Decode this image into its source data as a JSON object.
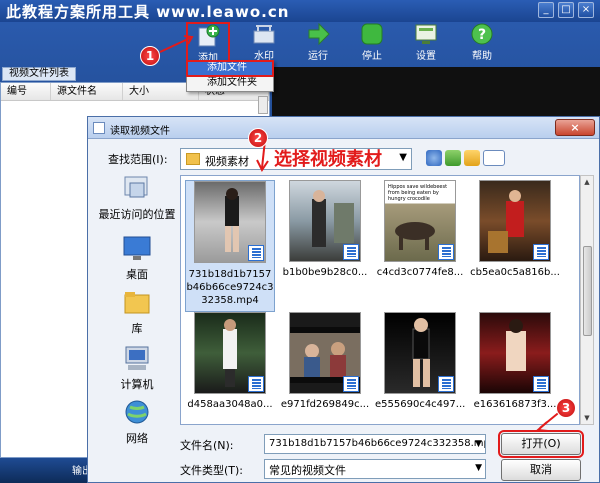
{
  "app": {
    "title": "此教程方案所用工具 www.leawo.cn",
    "window_buttons": [
      "_",
      "□",
      "×"
    ],
    "toolbar": [
      {
        "label": "添加",
        "icon": "add-file-icon"
      },
      {
        "label": "水印",
        "icon": "watermark-icon"
      },
      {
        "label": "运行",
        "icon": "run-icon"
      },
      {
        "label": "停止",
        "icon": "stop-icon"
      },
      {
        "label": "设置",
        "icon": "settings-icon"
      },
      {
        "label": "帮助",
        "icon": "help-icon"
      }
    ],
    "panel_tab": "视频文件列表",
    "list_columns": [
      "编号",
      "源文件名",
      "大小",
      "状态"
    ],
    "status_text": "输出"
  },
  "add_menu": {
    "items": [
      "添加文件",
      "添加文件夹"
    ]
  },
  "dialog": {
    "title": "读取视频文件",
    "close_label": "×",
    "lookin_label": "查找范围(I):",
    "lookin_value": "视频素材",
    "places": [
      {
        "label": "最近访问的位置",
        "icon": "recent-places-icon"
      },
      {
        "label": "桌面",
        "icon": "desktop-icon"
      },
      {
        "label": "库",
        "icon": "library-icon"
      },
      {
        "label": "计算机",
        "icon": "computer-icon"
      },
      {
        "label": "网络",
        "icon": "network-icon"
      }
    ],
    "files": [
      {
        "name": "731b18d1b7157b46b66ce9724c332358.mp4",
        "selected": true
      },
      {
        "name": "b1b0be9b28c0..."
      },
      {
        "name": "c4cd3c0774fe8..."
      },
      {
        "name": "cb5ea0c5a816b..."
      },
      {
        "name": "d458aa3048a0..."
      },
      {
        "name": "e971fd269849c..."
      },
      {
        "name": "e555690c4c497..."
      },
      {
        "name": "e163616873f3..."
      }
    ],
    "thumb3_caption": "Hippos save wildebeest from being eaten by hungry crocodile",
    "filename_label": "文件名(N):",
    "filename_value": "731b18d1b7157b46b66ce9724c332358.mp4",
    "filetype_label": "文件类型(T):",
    "filetype_value": "常见的视频文件",
    "open_label": "打开(O)",
    "cancel_label": "取消"
  },
  "annotations": {
    "step1": "1",
    "step2": "2",
    "step3": "3",
    "note": "选择视频素材"
  },
  "colors": {
    "annotation_red": "#e21b1b",
    "titlebar_blue": "#1b4591",
    "selection_blue": "#3a6fd0"
  }
}
